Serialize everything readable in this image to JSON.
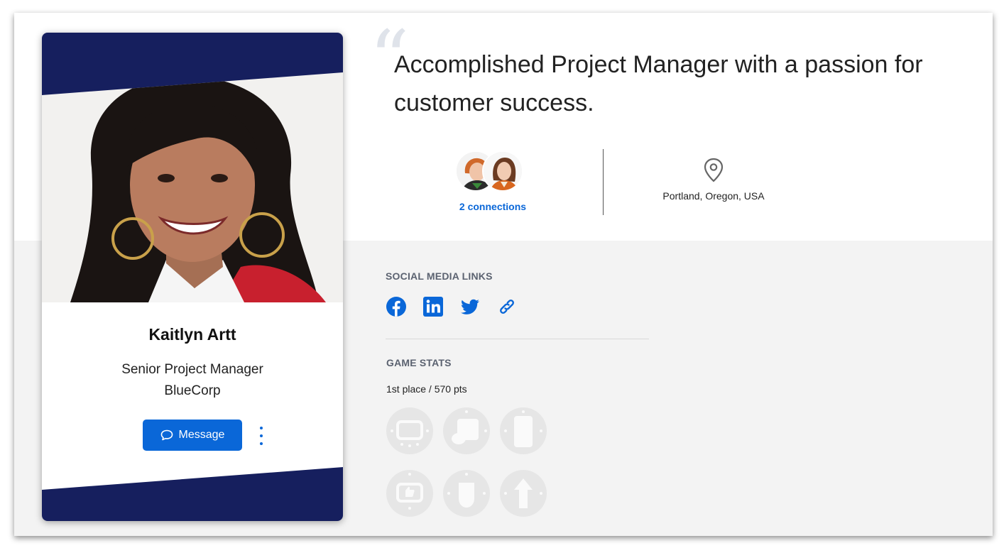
{
  "profile": {
    "name": "Kaitlyn Artt",
    "job_title": "Senior Project Manager",
    "company": "BlueCorp",
    "message_button_label": "Message"
  },
  "quote": {
    "mark": "“",
    "text": "Accomplished Project Manager with a passion for customer success."
  },
  "connections": {
    "label": "2 connections",
    "count": 2
  },
  "location": {
    "text": "Portland, Oregon, USA"
  },
  "social": {
    "heading": "SOCIAL MEDIA LINKS",
    "links": [
      "facebook-icon",
      "linkedin-icon",
      "twitter-icon",
      "link-icon"
    ]
  },
  "game": {
    "heading": "GAME STATS",
    "score": "1st place / 570 pts",
    "badges": [
      "tv-badge-icon",
      "calendar-badge-icon",
      "phone-badge-icon",
      "thumbs-up-badge-icon",
      "hand-badge-icon",
      "arrow-up-badge-icon"
    ]
  },
  "colors": {
    "navy": "#161f5e",
    "accent_blue": "#0a67d8",
    "band_gray": "#f3f3f3"
  }
}
